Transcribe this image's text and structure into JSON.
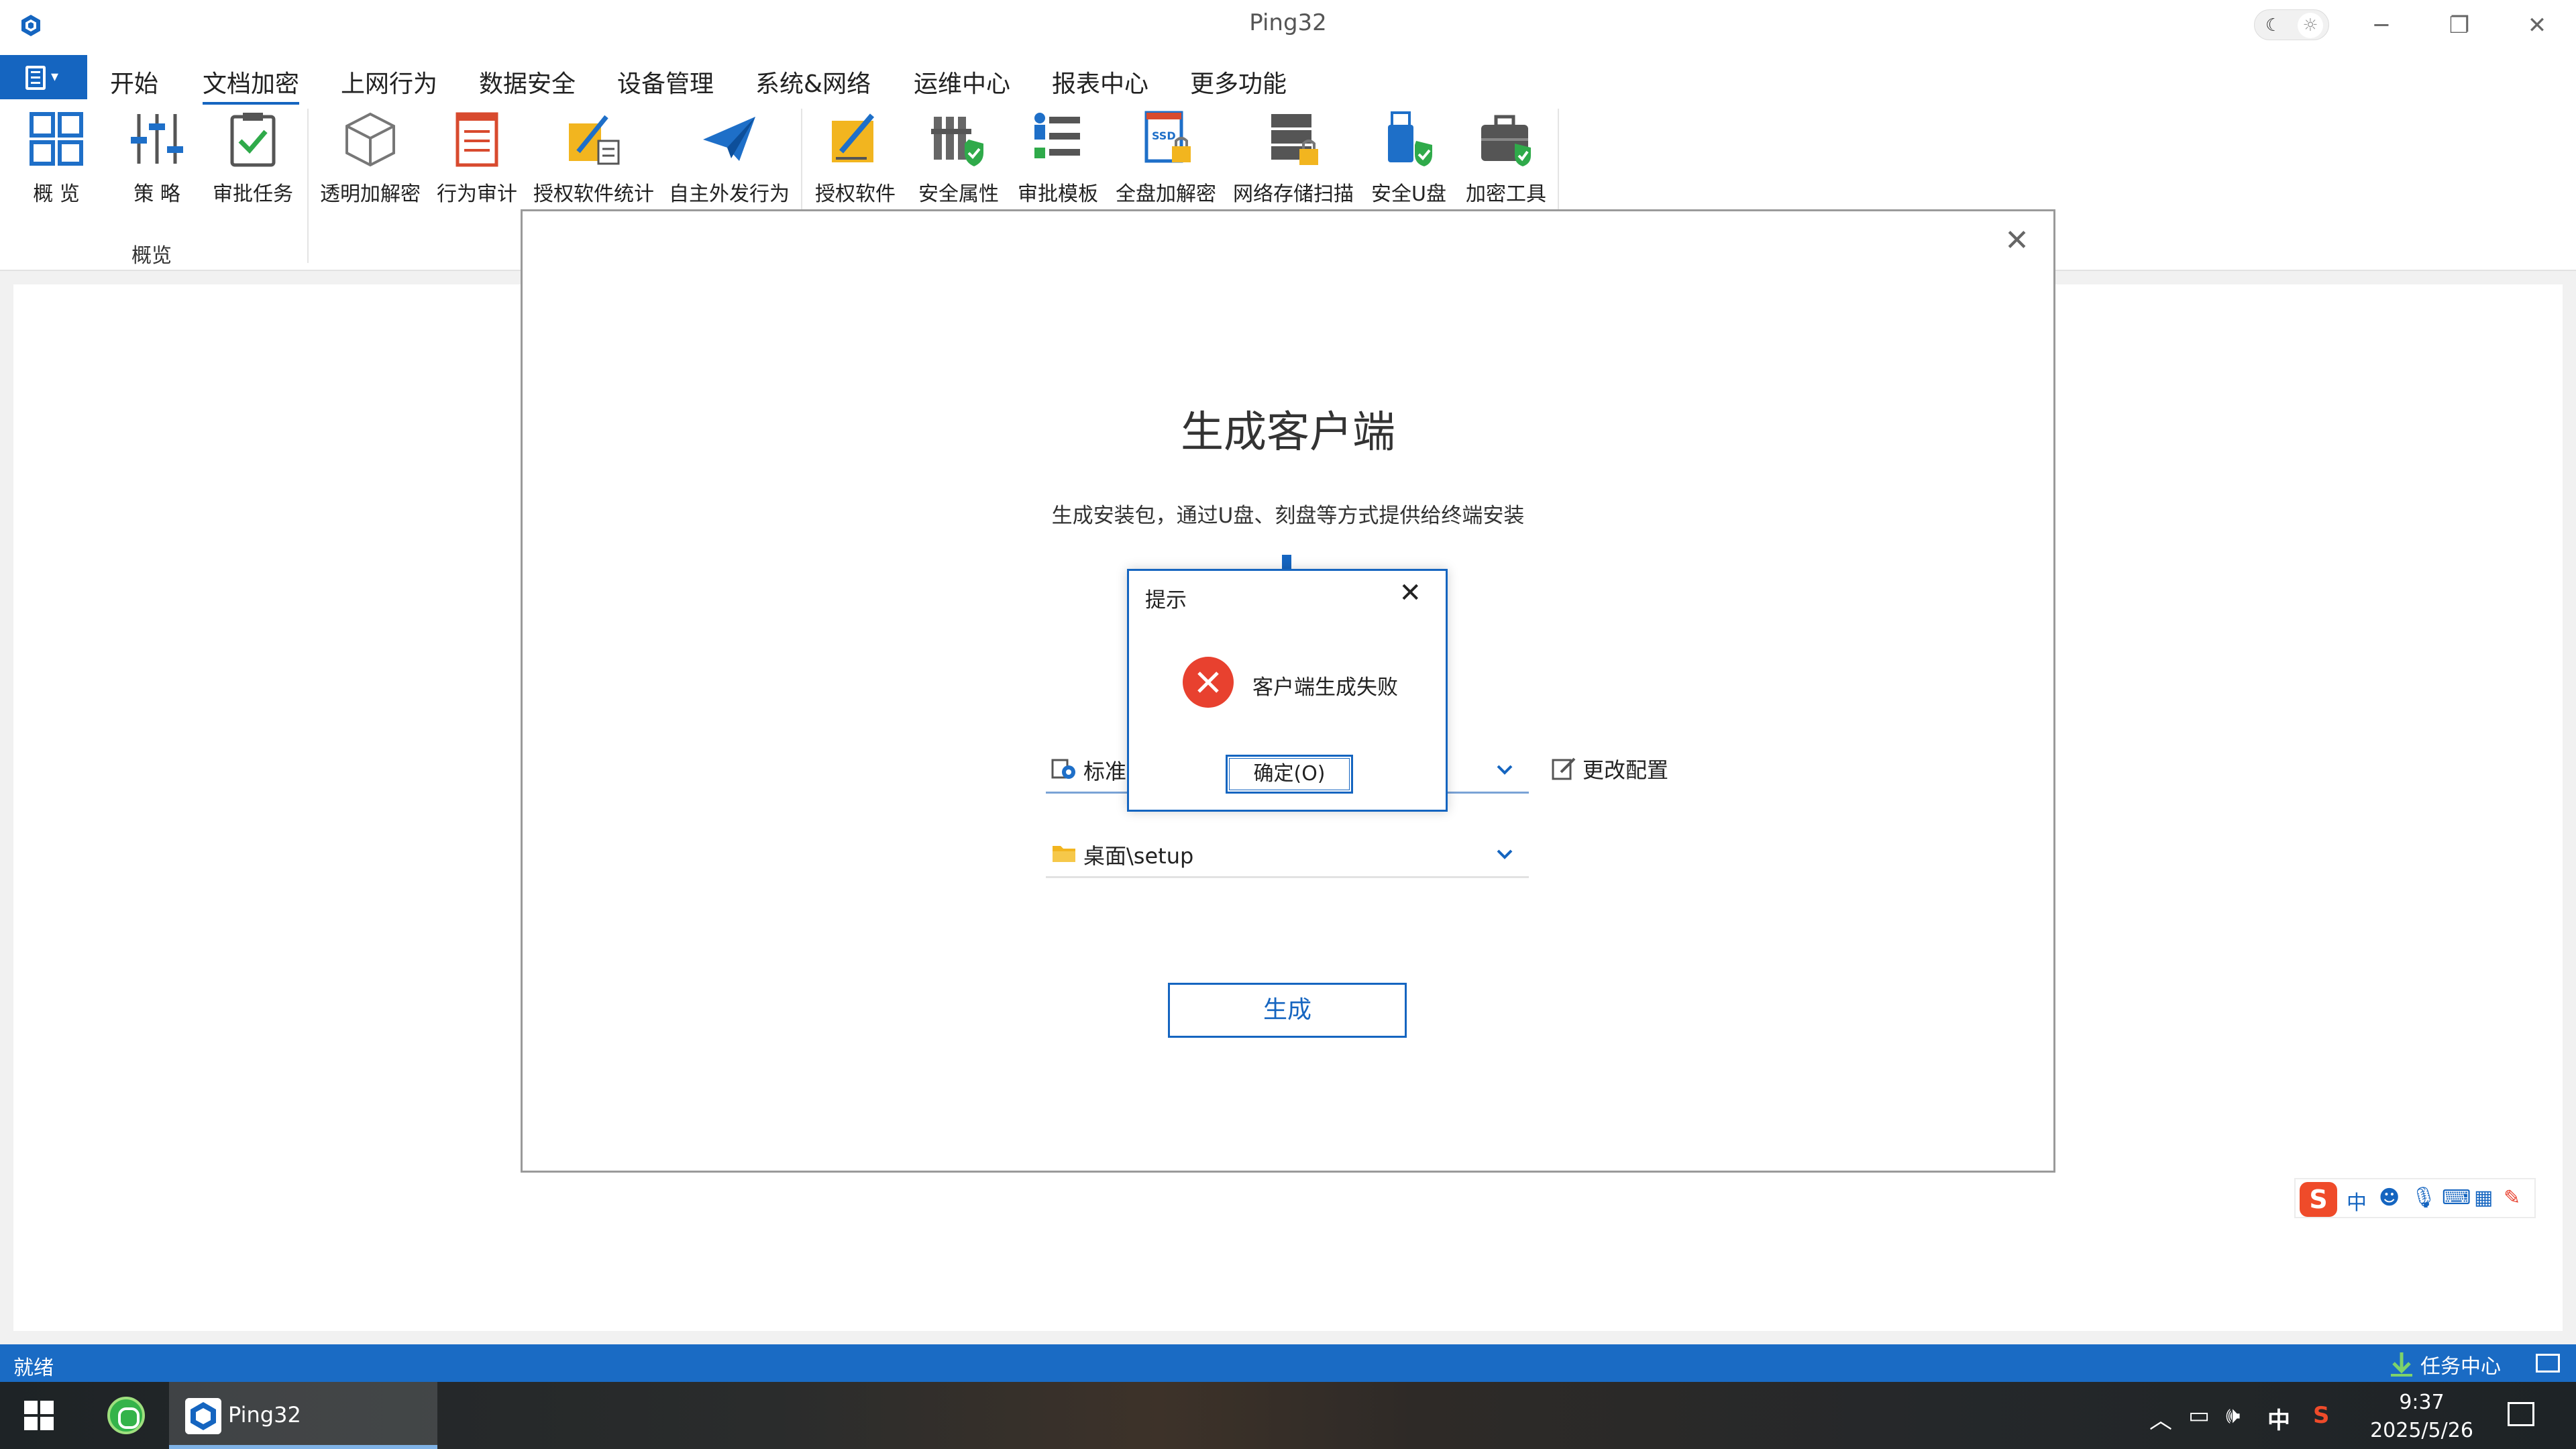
{
  "window": {
    "title": "Ping32"
  },
  "menu": {
    "items": [
      {
        "label": "开始",
        "active": false
      },
      {
        "label": "文档加密",
        "active": true
      },
      {
        "label": "上网行为",
        "active": false
      },
      {
        "label": "数据安全",
        "active": false
      },
      {
        "label": "设备管理",
        "active": false
      },
      {
        "label": "系统&网络",
        "active": false
      },
      {
        "label": "运维中心",
        "active": false
      },
      {
        "label": "报表中心",
        "active": false
      },
      {
        "label": "更多功能",
        "active": false
      }
    ]
  },
  "ribbon": {
    "buttons": [
      {
        "label": "概 览",
        "icon": "overview-grid-icon"
      },
      {
        "label": "策 略",
        "icon": "policy-sliders-icon"
      },
      {
        "label": "审批任务",
        "icon": "approval-task-icon"
      },
      {
        "label": "透明加解密",
        "icon": "transparent-encrypt-cube-icon"
      },
      {
        "label": "行为审计",
        "icon": "behavior-audit-icon"
      },
      {
        "label": "授权软件统计",
        "icon": "software-stats-icon"
      },
      {
        "label": "自主外发行为",
        "icon": "send-plane-icon"
      },
      {
        "label": "授权软件",
        "icon": "authorized-software-icon"
      },
      {
        "label": "安全属性",
        "icon": "security-property-icon"
      },
      {
        "label": "审批模板",
        "icon": "approval-template-icon"
      },
      {
        "label": "全盘加解密",
        "icon": "ssd-encrypt-icon"
      },
      {
        "label": "网络存储扫描",
        "icon": "network-storage-scan-icon"
      },
      {
        "label": "安全U盘",
        "icon": "secure-usb-icon"
      },
      {
        "label": "加密工具",
        "icon": "encrypt-toolbox-icon"
      }
    ],
    "groups": [
      {
        "label": "概览"
      }
    ]
  },
  "generate_dialog": {
    "title": "生成客户端",
    "subtitle": "生成安装包，通过U盘、刻盘等方式提供给终端安装",
    "config_field": {
      "value": "标准"
    },
    "change_config_label": "更改配置",
    "path_field": {
      "value": "桌面\\setup"
    },
    "generate_button": "生成"
  },
  "message_box": {
    "title": "提示",
    "message": "客户端生成失败",
    "ok_button": "确定(O)",
    "icon": "error-icon"
  },
  "ime_toolbar": {
    "logo": "S",
    "mode": "中"
  },
  "status_bar": {
    "status": "就绪",
    "task_center": "任务中心"
  },
  "taskbar": {
    "app_name": "Ping32",
    "ime_indicator": "中",
    "time": "9:37",
    "date": "2025/5/26"
  },
  "colors": {
    "accent": "#1565c0",
    "status_bar": "#1a6bc4",
    "error": "#e8412f"
  }
}
